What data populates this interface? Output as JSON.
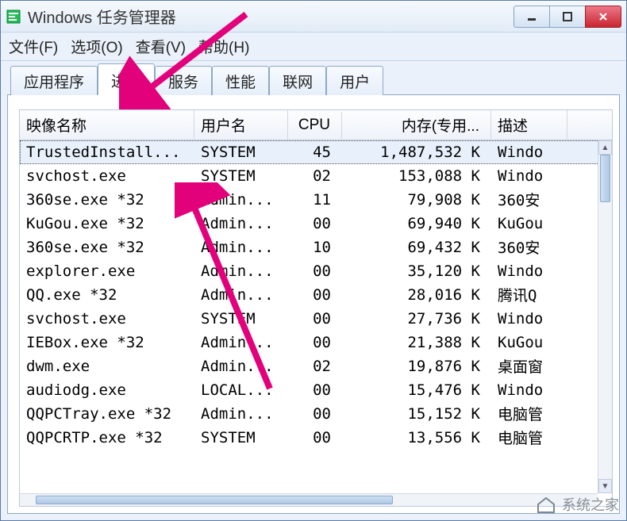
{
  "window": {
    "title": "Windows 任务管理器"
  },
  "menu": {
    "file": "文件(F)",
    "options": "选项(O)",
    "view": "查看(V)",
    "help": "帮助(H)"
  },
  "tabs": {
    "apps": "应用程序",
    "processes": "进程",
    "services": "服务",
    "performance": "性能",
    "networking": "联网",
    "users": "用户"
  },
  "columns": {
    "image": "映像名称",
    "user": "用户名",
    "cpu": "CPU",
    "mem": "内存(专用...",
    "desc": "描述"
  },
  "rows": [
    {
      "img": "TrustedInstall...",
      "user": "SYSTEM",
      "cpu": "45",
      "mem": "1,487,532 K",
      "desc": "Windo"
    },
    {
      "img": "svchost.exe",
      "user": "SYSTEM",
      "cpu": "02",
      "mem": "153,088 K",
      "desc": "Windo"
    },
    {
      "img": "360se.exe *32",
      "user": "Admin...",
      "cpu": "11",
      "mem": "79,908 K",
      "desc": "360安"
    },
    {
      "img": "KuGou.exe *32",
      "user": "Admin...",
      "cpu": "00",
      "mem": "69,940 K",
      "desc": "KuGou"
    },
    {
      "img": "360se.exe *32",
      "user": "Admin...",
      "cpu": "10",
      "mem": "69,432 K",
      "desc": "360安"
    },
    {
      "img": "explorer.exe",
      "user": "Admin...",
      "cpu": "00",
      "mem": "35,120 K",
      "desc": "Windo"
    },
    {
      "img": "QQ.exe *32",
      "user": "Admin...",
      "cpu": "00",
      "mem": "28,016 K",
      "desc": "腾讯Q"
    },
    {
      "img": "svchost.exe",
      "user": "SYSTEM",
      "cpu": "00",
      "mem": "27,736 K",
      "desc": "Windo"
    },
    {
      "img": "IEBox.exe *32",
      "user": "Admin...",
      "cpu": "00",
      "mem": "21,388 K",
      "desc": "KuGou"
    },
    {
      "img": "dwm.exe",
      "user": "Admin...",
      "cpu": "02",
      "mem": "19,876 K",
      "desc": "桌面窗"
    },
    {
      "img": "audiodg.exe",
      "user": "LOCAL...",
      "cpu": "00",
      "mem": "15,476 K",
      "desc": "Windo"
    },
    {
      "img": "QQPCTray.exe *32",
      "user": "Admin...",
      "cpu": "00",
      "mem": "15,152 K",
      "desc": "电脑管"
    },
    {
      "img": "QQPCRTP.exe *32",
      "user": "SYSTEM",
      "cpu": "00",
      "mem": "13,556 K",
      "desc": "电脑管"
    }
  ],
  "watermark": "系统之家"
}
